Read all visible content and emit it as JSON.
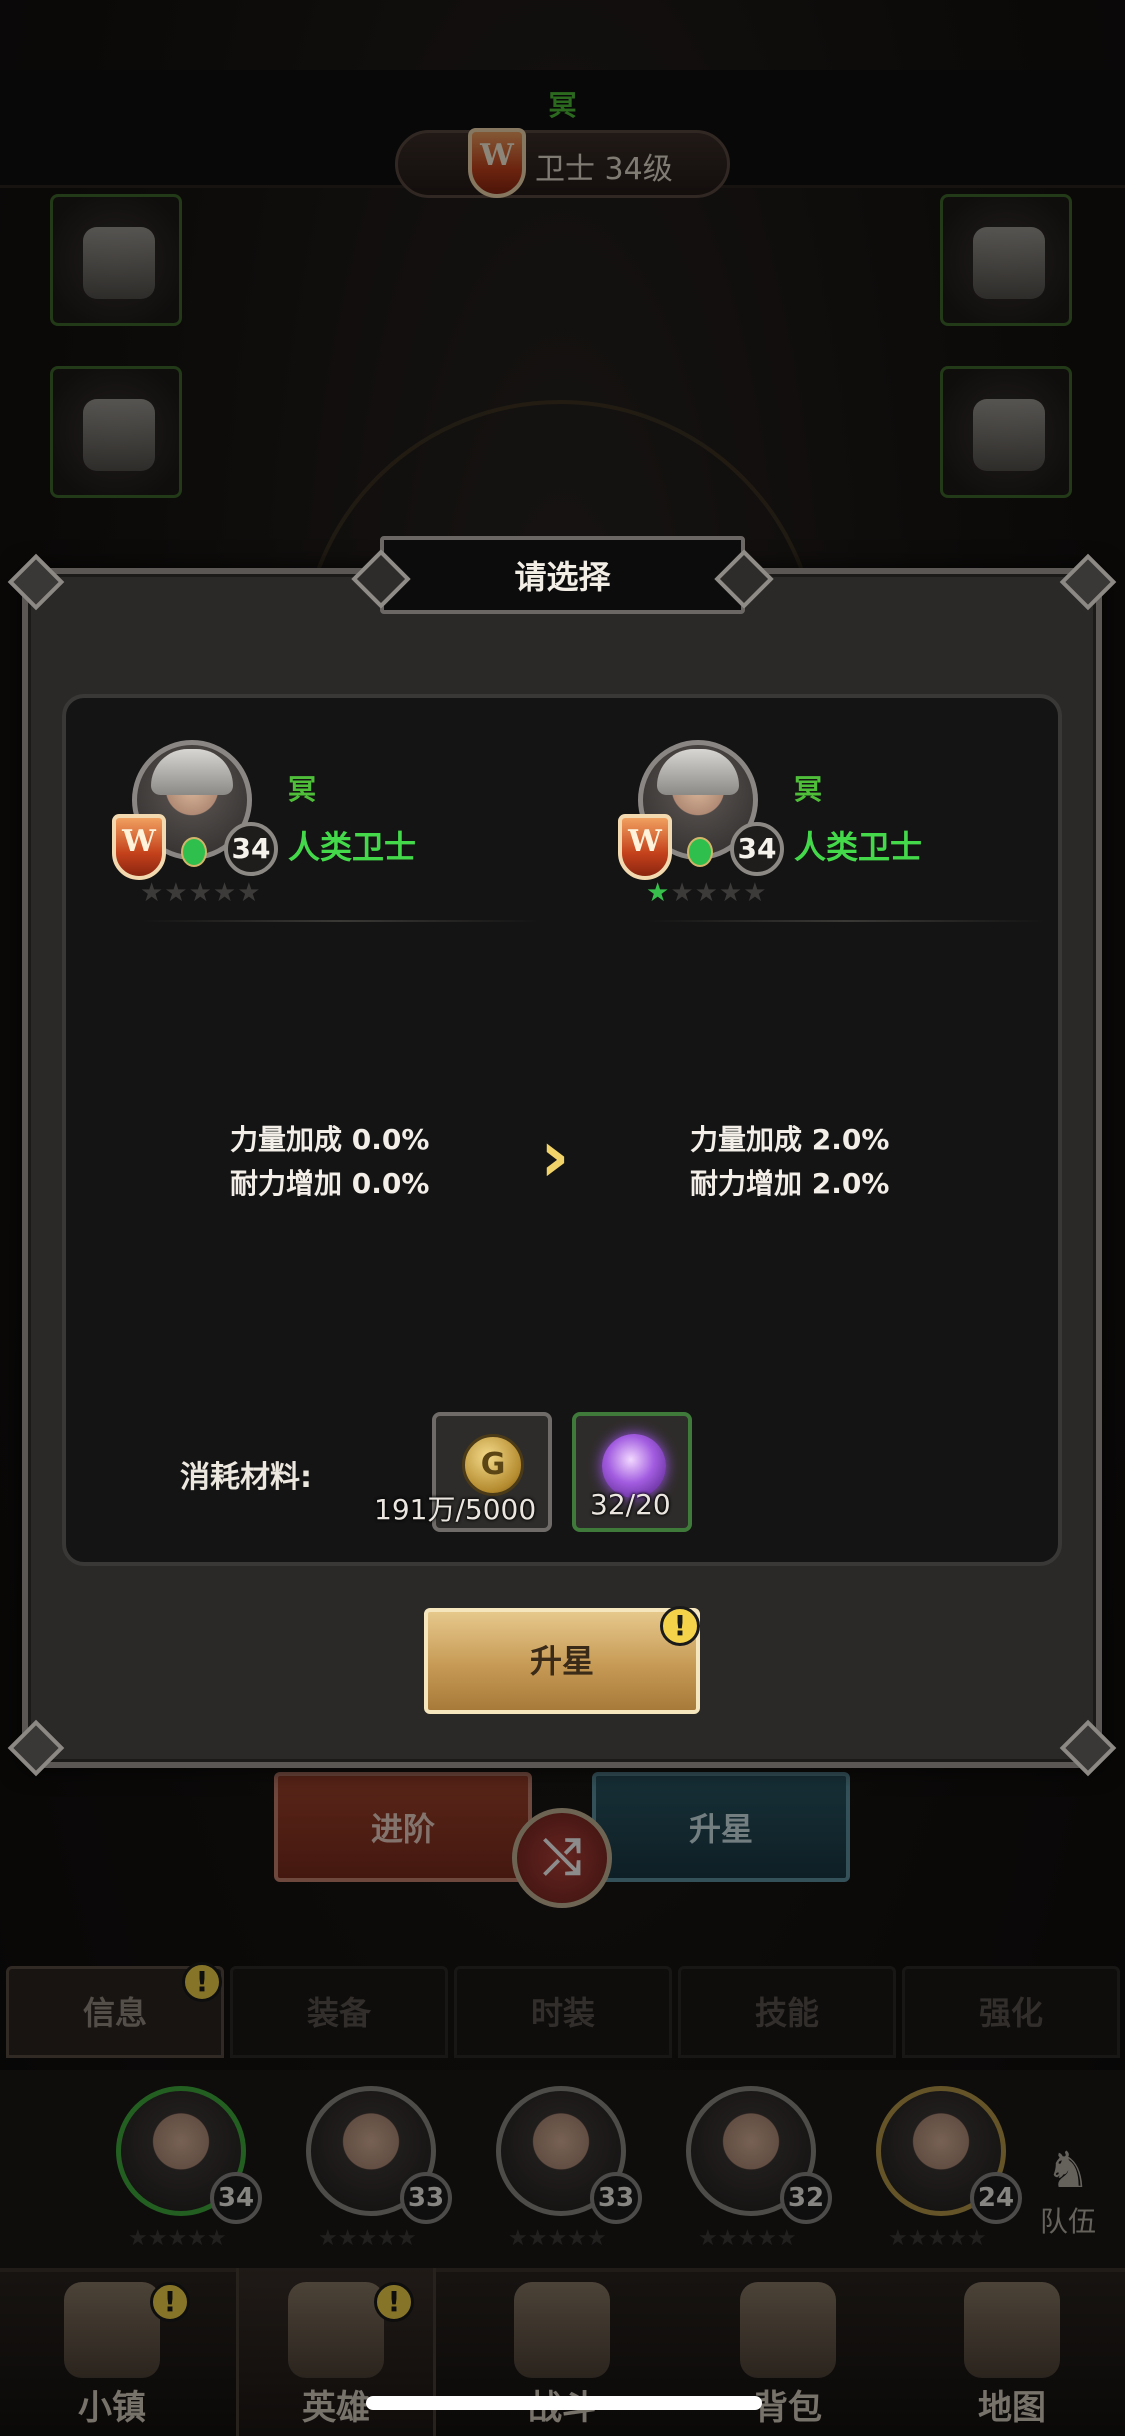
{
  "header": {
    "hero_name": "冥",
    "class_level": "卫士 34级"
  },
  "dialog": {
    "title": "请选择",
    "left_card": {
      "name": "冥",
      "class": "人类卫士",
      "level": "34",
      "stars_filled": 0,
      "stars_total": 5
    },
    "right_card": {
      "name": "冥",
      "class": "人类卫士",
      "level": "34",
      "stars_filled": 1,
      "stars_total": 5
    },
    "stats_before": [
      "力量加成 0.0%",
      "耐力增加 0.0%"
    ],
    "stats_after": [
      "力量加成 2.0%",
      "耐力增加 2.0%"
    ],
    "arrow_icon": "chevron-right-icon",
    "cost_label": "消耗材料:",
    "materials": [
      {
        "icon": "gold-coin-icon",
        "count": "191万/5000"
      },
      {
        "icon": "purple-orb-icon",
        "count": "32/20"
      }
    ],
    "confirm_button": "升星",
    "alert_mark": "!"
  },
  "action_tabs": {
    "advance": "进阶",
    "upstar": "升星",
    "swap_icon": "swap-icon"
  },
  "subtabs": [
    "信息",
    "装备",
    "时装",
    "技能",
    "强化"
  ],
  "roster": [
    {
      "level": "34"
    },
    {
      "level": "33"
    },
    {
      "level": "33"
    },
    {
      "level": "32"
    },
    {
      "level": "24"
    }
  ],
  "team_button": "队伍",
  "bottom_nav": [
    {
      "label": "小镇",
      "icon": "town-icon"
    },
    {
      "label": "英雄",
      "icon": "hero-icon"
    },
    {
      "label": "战斗",
      "icon": "battle-icon"
    },
    {
      "label": "背包",
      "icon": "bag-icon"
    },
    {
      "label": "地图",
      "icon": "map-icon"
    }
  ],
  "colors": {
    "accent_green": "#43d94a",
    "gold": "#c69a55",
    "panel": "#141414"
  }
}
